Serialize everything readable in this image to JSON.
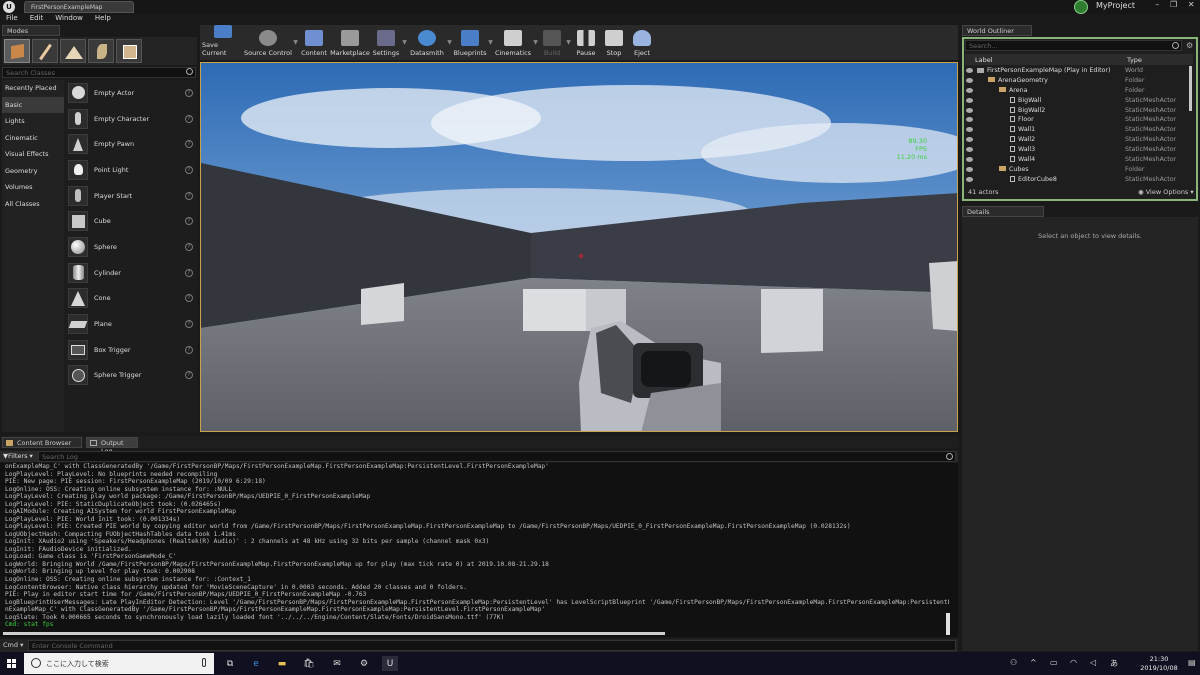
{
  "title_bar": {
    "tab": "FirstPersonExampleMap",
    "project": "MyProject"
  },
  "menu": [
    "File",
    "Edit",
    "Window",
    "Help"
  ],
  "modes": {
    "tab": "Modes",
    "search_placeholder": "Search Classes",
    "categories": [
      "Recently Placed",
      "Basic",
      "Lights",
      "Cinematic",
      "Visual Effects",
      "Geometry",
      "Volumes",
      "All Classes"
    ],
    "selected_category": "Basic",
    "items": [
      "Empty Actor",
      "Empty Character",
      "Empty Pawn",
      "Point Light",
      "Player Start",
      "Cube",
      "Sphere",
      "Cylinder",
      "Cone",
      "Plane",
      "Box Trigger",
      "Sphere Trigger"
    ]
  },
  "toolbar": [
    {
      "label": "Save Current",
      "icon": "save-icon",
      "color": "#4a7fc8"
    },
    {
      "label": "Source Control",
      "icon": "source-control-icon",
      "color": "#8a8a8a"
    },
    {
      "label": "Content",
      "icon": "content-icon",
      "color": "#6f8fd0"
    },
    {
      "label": "Marketplace",
      "icon": "marketplace-icon",
      "color": "#9a9a9a"
    },
    {
      "label": "Settings",
      "icon": "settings-icon",
      "color": "#6a6a8a"
    },
    {
      "label": "Datasmith",
      "icon": "datasmith-icon",
      "color": "#4a8ad0"
    },
    {
      "label": "Blueprints",
      "icon": "blueprints-icon",
      "color": "#4a7fc8"
    },
    {
      "label": "Cinematics",
      "icon": "cinematics-icon",
      "color": "#cfcfcf"
    },
    {
      "label": "Build",
      "icon": "build-icon",
      "color": "#555555"
    },
    {
      "label": "Pause",
      "icon": "pause-icon",
      "color": "#cfcfcf"
    },
    {
      "label": "Stop",
      "icon": "stop-icon",
      "color": "#cfcfcf"
    },
    {
      "label": "Eject",
      "icon": "eject-icon",
      "color": "#9ab4e0"
    }
  ],
  "viewport": {
    "fps": "89.30 FPS",
    "ms": "11.20 ms"
  },
  "world_outliner": {
    "tab": "World Outliner",
    "search_placeholder": "Search...",
    "col_label": "Label",
    "col_type": "Type",
    "rows": [
      {
        "label": "FirstPersonExampleMap (Play in Editor)",
        "type": "World",
        "indent": 0,
        "kind": "world"
      },
      {
        "label": "ArenaGeometry",
        "type": "Folder",
        "indent": 1,
        "kind": "folder"
      },
      {
        "label": "Arena",
        "type": "Folder",
        "indent": 2,
        "kind": "folder"
      },
      {
        "label": "BigWall",
        "type": "StaticMeshActor",
        "indent": 3,
        "kind": "mesh"
      },
      {
        "label": "BigWall2",
        "type": "StaticMeshActor",
        "indent": 3,
        "kind": "mesh"
      },
      {
        "label": "Floor",
        "type": "StaticMeshActor",
        "indent": 3,
        "kind": "mesh"
      },
      {
        "label": "Wall1",
        "type": "StaticMeshActor",
        "indent": 3,
        "kind": "mesh"
      },
      {
        "label": "Wall2",
        "type": "StaticMeshActor",
        "indent": 3,
        "kind": "mesh"
      },
      {
        "label": "Wall3",
        "type": "StaticMeshActor",
        "indent": 3,
        "kind": "mesh"
      },
      {
        "label": "Wall4",
        "type": "StaticMeshActor",
        "indent": 3,
        "kind": "mesh"
      },
      {
        "label": "Cubes",
        "type": "Folder",
        "indent": 2,
        "kind": "folder"
      },
      {
        "label": "EditorCube8",
        "type": "StaticMeshActor",
        "indent": 3,
        "kind": "mesh"
      }
    ],
    "actor_count": "41 actors",
    "view_options": "View Options"
  },
  "details": {
    "tab": "Details",
    "message": "Select an object to view details."
  },
  "bottom_tabs": [
    "Content Browser",
    "Output Log"
  ],
  "active_bottom_tab": "Output Log",
  "log": {
    "filters": "Filters",
    "search_placeholder": "Search Log",
    "lines": [
      "onExampleMap_C' with ClassGeneratedBy '/Game/FirstPersonBP/Maps/FirstPersonExampleMap.FirstPersonExampleMap:PersistentLevel.FirstPersonExampleMap'",
      "LogPlayLevel: PlayLevel: No blueprints needed recompiling",
      "PIE: New page: PIE session: FirstPersonExampleMap (2019/10/09 6:29:18)",
      "LogOnline: OSS: Creating online subsystem instance for: :NULL",
      "LogPlayLevel: Creating play world package: /Game/FirstPersonBP/Maps/UEDPIE_0_FirstPersonExampleMap",
      "LogPlayLevel: PIE: StaticDuplicateObject took: (0.026465s)",
      "LogAIModule: Creating AISystem for world FirstPersonExampleMap",
      "LogPlayLevel: PIE: World Init took: (0.001334s)",
      "LogPlayLevel: PIE: Created PIE world by copying editor world from /Game/FirstPersonBP/Maps/FirstPersonExampleMap.FirstPersonExampleMap to /Game/FirstPersonBP/Maps/UEDPIE_0_FirstPersonExampleMap.FirstPersonExampleMap (0.028132s)",
      "LogUObjectHash: Compacting FUObjectHashTables data took   1.41ms",
      "LogInit: XAudio2 using 'Speakers/Headphones (Realtek(R) Audio)' : 2 channels at 48 kHz using 32 bits per sample (channel mask 0x3)",
      "LogInit: FAudioDevice initialized.",
      "LogLoad: Game class is 'FirstPersonGameMode_C'",
      "LogWorld: Bringing World /Game/FirstPersonBP/Maps/FirstPersonExampleMap.FirstPersonExampleMap up for play (max tick rate 0) at 2019.10.08-21.29.18",
      "LogWorld: Bringing up level for play took: 0.002908",
      "LogOnline: OSS: Creating online subsystem instance for: :Context_1",
      "LogContentBrowser: Native class hierarchy updated for 'MovieSceneCapture' in 0.0003 seconds. Added 20 classes and 0 folders.",
      "PIE: Play in editor start time for /Game/FirstPersonBP/Maps/UEDPIE_0_FirstPersonExampleMap -0.763",
      "LogBlueprintUserMessages: Late PlayInEditor Detection: Level '/Game/FirstPersonBP/Maps/FirstPersonExampleMap.FirstPersonExampleMap:PersistentLevel' has LevelScriptBlueprint '/Game/FirstPersonBP/Maps/FirstPersonExampleMap.FirstPersonExampleMap:PersistentLevel.FirstPersonExampleMap' with GeneratedClass '/Game/FirstPersonBP/Maps/FirstPersonExampleMap.FirstPersonExampleMap_C' with ClassGeneratedBy '/Game/FirstPersonBP/Maps/FirstPersonExampleMap.FirstPersonExampleMap:PersistentLevel.FirstPersonExampleMap'",
      "nExampleMap_C' with ClassGeneratedBy '/Game/FirstPersonBP/Maps/FirstPersonExampleMap.FirstPersonExampleMap:PersistentLevel.FirstPersonExampleMap'",
      "LogSlate: Took 0.000665 seconds to synchronously load lazily loaded font '../../../Engine/Content/Slate/Fonts/DroidSansMono.ttf' (77K)",
      "Cmd: stat fps"
    ],
    "cmd_label": "Cmd",
    "cmd_placeholder": "Enter Console Command"
  },
  "taskbar": {
    "search_placeholder": "ここに入力して検索",
    "time": "21:30",
    "date": "2019/10/08"
  }
}
